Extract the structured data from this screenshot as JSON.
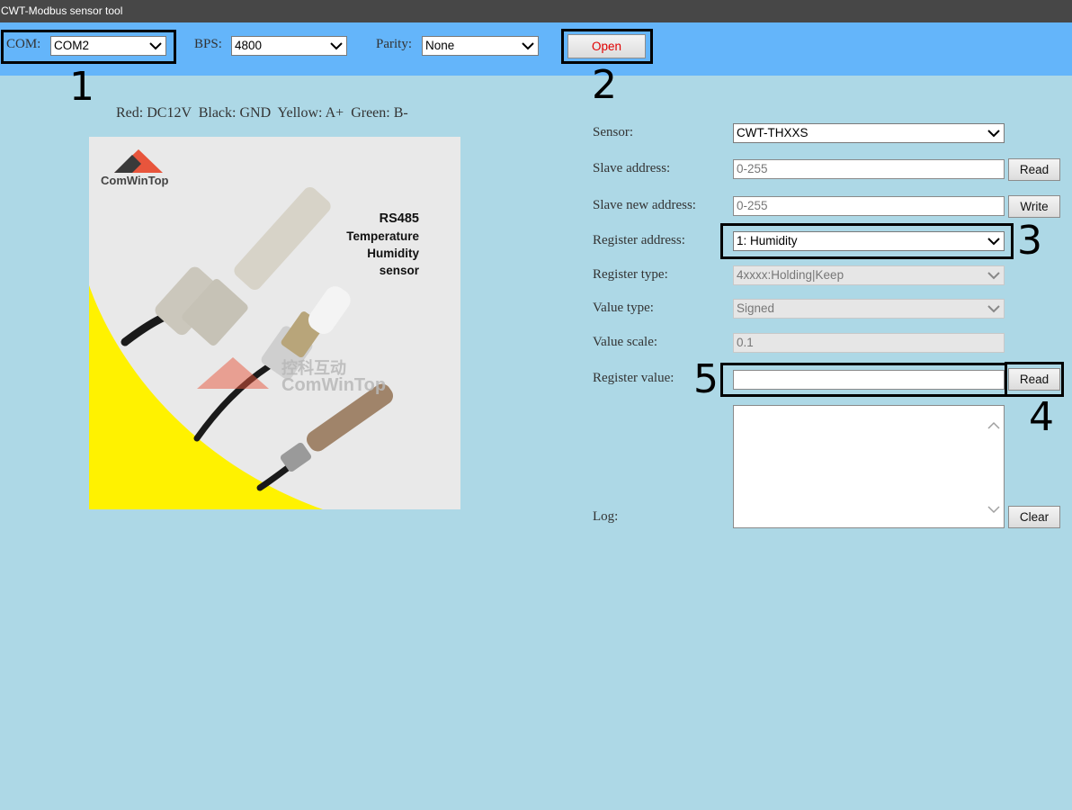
{
  "window": {
    "title": "CWT-Modbus sensor tool"
  },
  "toolbar": {
    "com_label": "COM:",
    "com_value": "COM2",
    "bps_label": "BPS:",
    "bps_value": "4800",
    "parity_label": "Parity:",
    "parity_value": "None",
    "open_label": "Open"
  },
  "wiring_note": "Red: DC12V  Black: GND  Yellow: A+  Green: B-",
  "product_image": {
    "brand": "ComWinTop",
    "watermark_cn": "控科互动",
    "watermark_en": "ComWinTop",
    "caption_lines": [
      "RS485",
      "Temperature",
      "Humidity",
      "sensor"
    ]
  },
  "form": {
    "sensor_label": "Sensor:",
    "sensor_value": "CWT-THXXS",
    "slave_address_label": "Slave address:",
    "slave_address_placeholder": "0-255",
    "read_label": "Read",
    "slave_new_address_label": "Slave new address:",
    "slave_new_address_placeholder": "0-255",
    "write_label": "Write",
    "register_address_label": "Register address:",
    "register_address_value": "1: Humidity",
    "register_type_label": "Register type:",
    "register_type_value": "4xxxx:Holding|Keep",
    "value_type_label": "Value type:",
    "value_type_value": "Signed",
    "value_scale_label": "Value scale:",
    "value_scale_value": "0.1",
    "register_value_label": "Register value:",
    "register_value": "",
    "register_read_label": "Read",
    "log_label": "Log:",
    "log_content": "",
    "clear_label": "Clear"
  },
  "annotations": [
    "1",
    "2",
    "3",
    "4",
    "5"
  ],
  "colors": {
    "title_bar": "#474747",
    "toolbar": "#64b5fa",
    "background": "#add8e6",
    "open_text": "#e00000",
    "highlight_box": "#000000"
  }
}
